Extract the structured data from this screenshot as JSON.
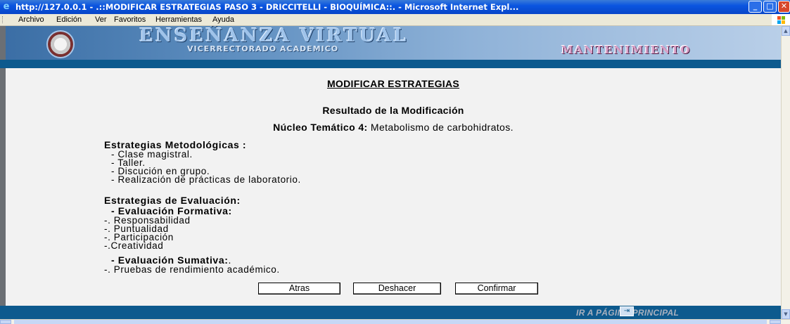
{
  "window": {
    "title": "http://127.0.0.1 - .::MODIFICAR ESTRATEGIAS PASO 3 - DRICCITELLI - BIOQUÍMICA::. - Microsoft Internet Expl..."
  },
  "menubar": {
    "items": [
      "Archivo",
      "Edición",
      "Ver",
      "Favoritos",
      "Herramientas",
      "Ayuda"
    ]
  },
  "banner": {
    "brand": "ENSEÑANZA VIRTUAL",
    "subtitle": "VICERRECTORADO ACADEMICO",
    "section": "MANTENIMIENTO"
  },
  "main": {
    "page_title": "MODIFICAR ESTRATEGIAS",
    "result_title": "Resultado de la Modificación",
    "nucleo_label": "Núcleo Temático 4:",
    "nucleo_value": " Metabolismo de carbohidratos.",
    "metodologicas": {
      "heading": "Estrategias Metodológicas :",
      "items": [
        "- Clase magistral.",
        "- Taller.",
        "- Discución en grupo.",
        "- Realización de prácticas de laboratorio."
      ]
    },
    "evaluacion": {
      "heading": "Estrategias de Evaluación:",
      "formativa_heading": "- Evaluación Formativa:",
      "formativa_items": [
        "-. Responsabilidad",
        "-. Puntualidad",
        "-. Participación",
        "-.Creatividad"
      ],
      "sumativa_heading": "- Evaluación Sumativa:",
      "sumativa_suffix": ".",
      "sumativa_items": [
        "-. Pruebas de rendimiento académico."
      ]
    },
    "buttons": {
      "back": "Atras",
      "undo": "Deshacer",
      "confirm": "Confirmar"
    }
  },
  "footer": {
    "home_link": "IR A PÁGINA PRINCIPAL"
  },
  "colors": {
    "stripe": "#0d5a8e",
    "content_bg": "#f2f2f2",
    "titlebar": "#0a55e0"
  }
}
